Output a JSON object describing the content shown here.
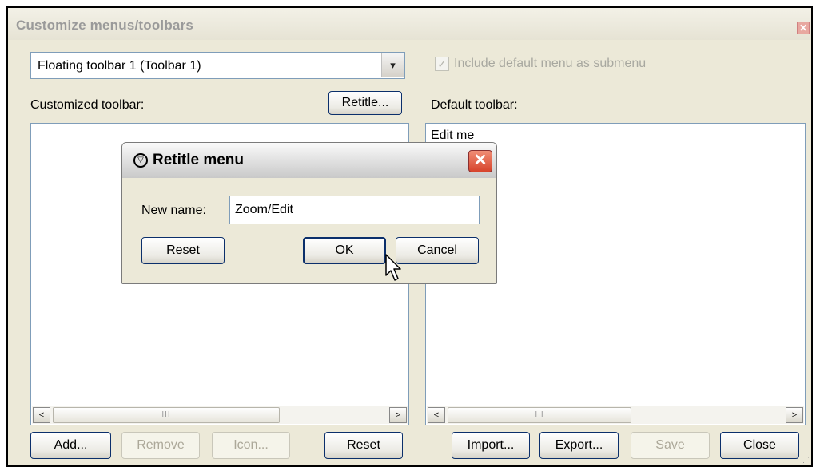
{
  "window": {
    "title": "Customize menus/toolbars",
    "close_glyph": "✕"
  },
  "toolbar_select": {
    "selected": "Floating toolbar 1 (Toolbar 1)",
    "arrow_glyph": "▾"
  },
  "include_default": {
    "checked": true,
    "check_glyph": "✓",
    "label": "Include default menu as submenu"
  },
  "customized": {
    "label": "Customized toolbar:",
    "retitle_label": "Retitle...",
    "items": []
  },
  "default_list": {
    "label": "Default toolbar:",
    "items": [
      "Edit me"
    ]
  },
  "scrollbar": {
    "left_glyph": "<",
    "right_glyph": ">",
    "thumb_grip": "III"
  },
  "bottom_buttons": {
    "add": "Add...",
    "remove": "Remove",
    "icon": "Icon...",
    "reset": "Reset",
    "import": "Import...",
    "export": "Export...",
    "save": "Save",
    "close": "Close"
  },
  "retitle_dialog": {
    "title": "Retitle menu",
    "close_glyph": "✕",
    "icon_glyph": "▽",
    "name_label": "New name:",
    "name_value": "Zoom/Edit",
    "reset": "Reset",
    "ok": "OK",
    "cancel": "Cancel"
  },
  "colors": {
    "window_bg": "#ece9d8",
    "button_border": "#0b2f6b",
    "dialog_close": "#d7432b"
  },
  "icons": [
    "close-icon",
    "dropdown-arrow-icon",
    "checkbox-icon",
    "dialog-app-icon",
    "mouse-cursor-icon",
    "resize-grip-icon"
  ]
}
